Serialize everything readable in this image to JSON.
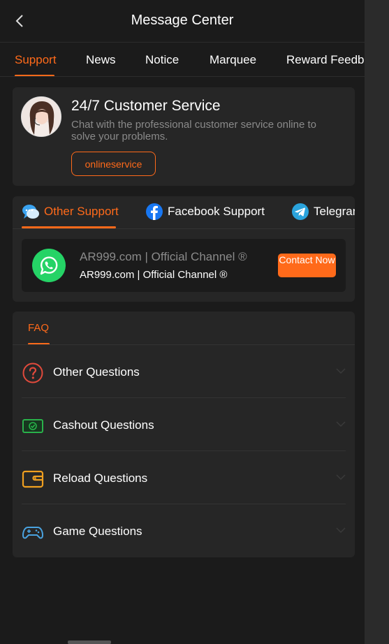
{
  "header": {
    "title": "Message Center",
    "back_icon": "chevron-left-icon"
  },
  "tabs": [
    {
      "label": "Support",
      "active": true
    },
    {
      "label": "News"
    },
    {
      "label": "Notice"
    },
    {
      "label": "Marquee"
    },
    {
      "label": "Reward Feedb"
    }
  ],
  "customer_service": {
    "title": "24/7 Customer Service",
    "description": "Chat with the professional customer service online to solve your problems.",
    "button": "onlineservice"
  },
  "support": {
    "tabs": [
      {
        "label": "Other Support",
        "icon": "chat-bubble-icon",
        "active": true
      },
      {
        "label": "Facebook Support",
        "icon": "facebook-icon"
      },
      {
        "label": "Telegran",
        "icon": "telegram-icon"
      }
    ],
    "channel": {
      "icon": "whatsapp-icon",
      "title": "AR999.com | Official Channel ®",
      "subtitle": "AR999.com | Official Channel ®",
      "button": "Contact Now"
    }
  },
  "faq": {
    "tab": "FAQ",
    "items": [
      {
        "label": "Other Questions",
        "icon": "question-circle-icon"
      },
      {
        "label": "Cashout Questions",
        "icon": "cash-icon"
      },
      {
        "label": "Reload Questions",
        "icon": "wallet-icon"
      },
      {
        "label": "Game Questions",
        "icon": "gamepad-icon"
      }
    ]
  },
  "colors": {
    "accent": "#ff6a1a",
    "background": "#1b1b1b",
    "card": "#262626"
  }
}
